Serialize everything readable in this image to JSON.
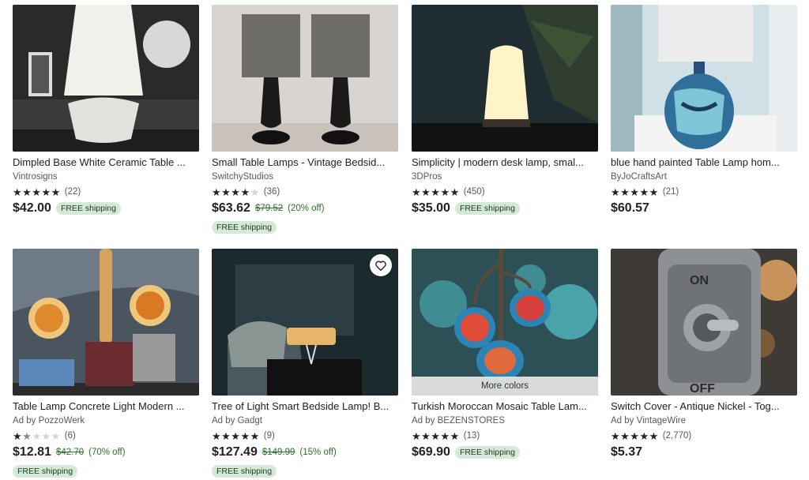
{
  "listings": [
    {
      "title": "Dimpled Base White Ceramic Table ...",
      "shop": "Vintrosigns",
      "rating": 5,
      "reviews": "(22)",
      "price": "$42.00",
      "badge": "FREE shipping"
    },
    {
      "title": "Small Table Lamps - Vintage Bedsid...",
      "shop": "SwitchyStudios",
      "rating": 4,
      "reviews": "(36)",
      "price": "$63.62",
      "original_price": "$79.52",
      "discount": "(20% off)",
      "badge": "FREE shipping"
    },
    {
      "title": "Simplicity | modern desk lamp, smal...",
      "shop": "3DPros",
      "rating": 5,
      "reviews": "(450)",
      "price": "$35.00",
      "badge": "FREE shipping"
    },
    {
      "title": "blue hand painted Table Lamp hom...",
      "shop": "ByJoCraftsArt",
      "rating": 5,
      "reviews": "(21)",
      "price": "$60.57"
    },
    {
      "title": "Table Lamp Concrete Light Modern ...",
      "shop": "Ad by PozzoWerk",
      "rating": 1.5,
      "reviews": "(6)",
      "price": "$12.81",
      "original_price": "$42.70",
      "discount": "(70% off)",
      "badge": "FREE shipping"
    },
    {
      "title": "Tree of Light Smart Bedside Lamp! B...",
      "shop": "Ad by Gadgt",
      "rating": 5,
      "reviews": "(9)",
      "price": "$127.49",
      "original_price": "$149.99",
      "discount": "(15% off)",
      "badge": "FREE shipping"
    },
    {
      "title": "Turkish Moroccan Mosaic Table Lam...",
      "shop": "Ad by BEZENSTORES",
      "rating": 5,
      "reviews": "(13)",
      "price": "$69.90",
      "badge": "FREE shipping",
      "overlay": "More colors"
    },
    {
      "title": "Switch Cover - Antique Nickel - Tog...",
      "shop": "Ad by VintageWire",
      "rating": 5,
      "reviews": "(2,770)",
      "price": "$5.37"
    }
  ]
}
